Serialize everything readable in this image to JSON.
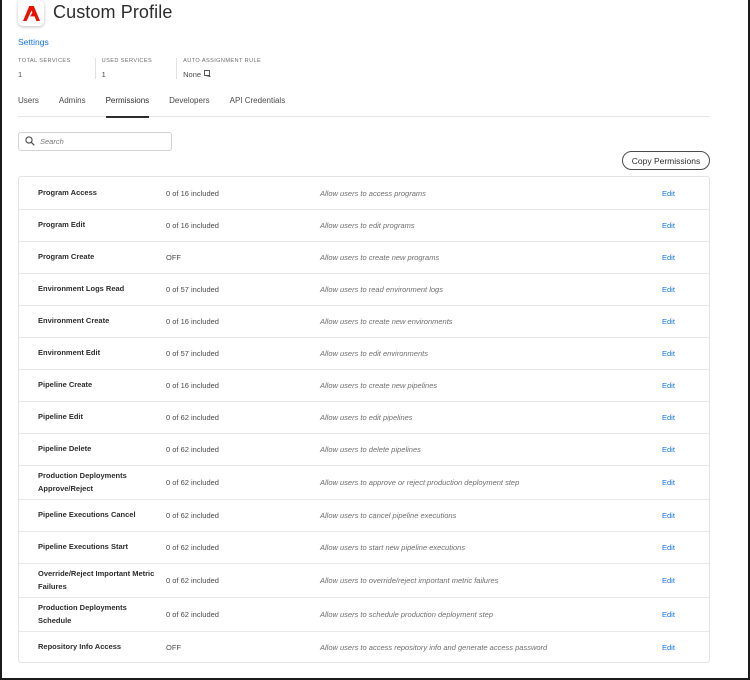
{
  "brand": {
    "accent": "#1473e6",
    "logo_color": "#eb1000"
  },
  "header": {
    "title": "Custom Profile",
    "logo_icon": "adobe-logo-icon"
  },
  "breadcrumb": {
    "settings_label": "Settings"
  },
  "stats": [
    {
      "label": "TOTAL SERVICES",
      "value": "1"
    },
    {
      "label": "USED SERVICES",
      "value": "1"
    },
    {
      "label": "AUTO ASSIGNMENT RULE",
      "value": "None",
      "icon": "info-icon"
    }
  ],
  "tabs": [
    {
      "label": "Users",
      "active": false
    },
    {
      "label": "Admins",
      "active": false
    },
    {
      "label": "Permissions",
      "active": true
    },
    {
      "label": "Developers",
      "active": false
    },
    {
      "label": "API Credentials",
      "active": false
    }
  ],
  "search": {
    "placeholder": "Search",
    "icon": "search-icon"
  },
  "actions": {
    "copy_permissions_label": "Copy Permissions"
  },
  "permissions": [
    {
      "name": "Program Access",
      "count": "0 of 16 included",
      "description": "Allow users to access programs",
      "edit": "Edit"
    },
    {
      "name": "Program Edit",
      "count": "0 of 16 included",
      "description": "Allow users to edit programs",
      "edit": "Edit"
    },
    {
      "name": "Program Create",
      "count": "OFF",
      "description": "Allow users to create new programs",
      "edit": "Edit"
    },
    {
      "name": "Environment Logs Read",
      "count": "0 of 57 included",
      "description": "Allow users to read environment logs",
      "edit": "Edit"
    },
    {
      "name": "Environment Create",
      "count": "0 of 16 included",
      "description": "Allow users to create new environments",
      "edit": "Edit"
    },
    {
      "name": "Environment Edit",
      "count": "0 of 57 included",
      "description": "Allow users to edit environments",
      "edit": "Edit"
    },
    {
      "name": "Pipeline Create",
      "count": "0 of 16 included",
      "description": "Allow users to create new pipelines",
      "edit": "Edit"
    },
    {
      "name": "Pipeline Edit",
      "count": "0 of 62 included",
      "description": "Allow users to edit pipelines",
      "edit": "Edit"
    },
    {
      "name": "Pipeline Delete",
      "count": "0 of 62 included",
      "description": "Allow users to delete pipelines",
      "edit": "Edit"
    },
    {
      "name": "Production Deployments Approve/Reject",
      "count": "0 of 62 included",
      "description": "Allow users to approve or reject production deployment step",
      "edit": "Edit"
    },
    {
      "name": "Pipeline Executions Cancel",
      "count": "0 of 62 included",
      "description": "Allow users to cancel pipeline executions",
      "edit": "Edit"
    },
    {
      "name": "Pipeline Executions Start",
      "count": "0 of 62 included",
      "description": "Allow users to start new pipeline executions",
      "edit": "Edit"
    },
    {
      "name": "Override/Reject Important Metric Failures",
      "count": "0 of 62 included",
      "description": "Allow users to override/reject important metric failures",
      "edit": "Edit"
    },
    {
      "name": "Production Deployments Schedule",
      "count": "0 of 62 included",
      "description": "Allow users to schedule production deployment step",
      "edit": "Edit"
    },
    {
      "name": "Repository Info Access",
      "count": "OFF",
      "description": "Allow users to access repository info and generate access password",
      "edit": "Edit"
    }
  ]
}
